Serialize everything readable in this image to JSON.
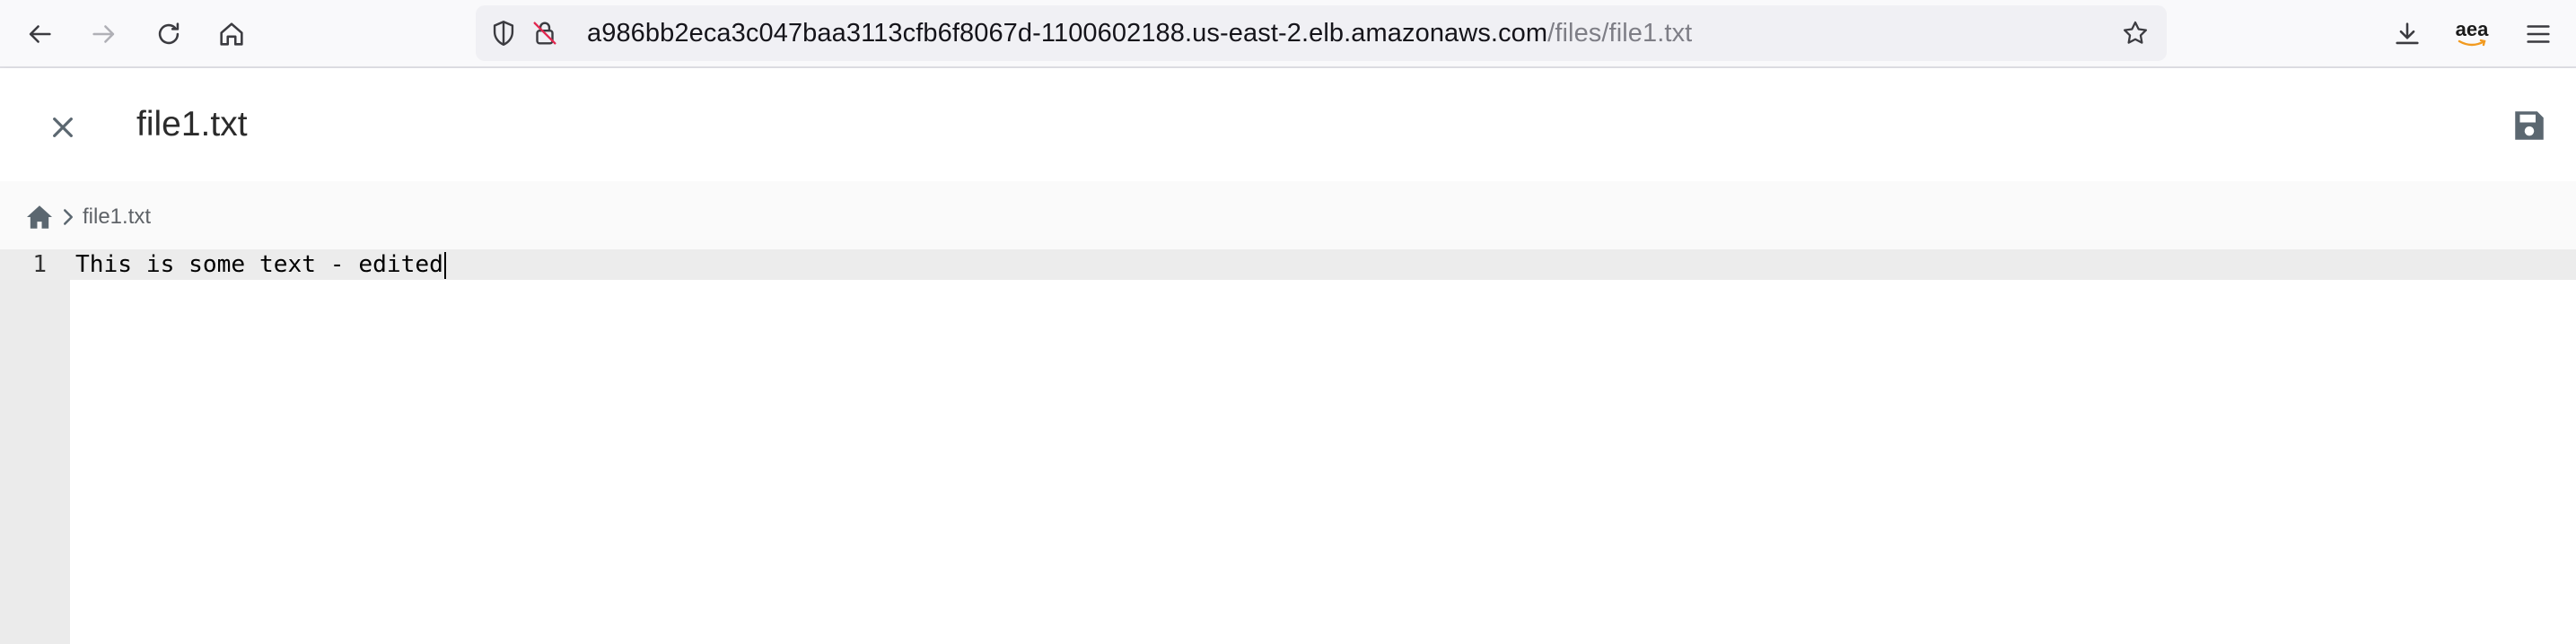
{
  "browser": {
    "url_host": "a986bb2eca3c047baa3113cfb6f8067d-1100602188.us-east-2.elb.amazonaws.com",
    "url_path": "/files/file1.txt",
    "account_label": "aea",
    "icons": [
      "back-icon",
      "forward-icon",
      "reload-icon",
      "home-icon",
      "shield-icon",
      "insecure-lock-icon",
      "bookmark-star-icon",
      "download-icon",
      "amazon-account-icon",
      "menu-icon"
    ]
  },
  "header": {
    "title": "file1.txt",
    "icons": [
      "close-icon",
      "save-icon"
    ]
  },
  "breadcrumb": {
    "items": [
      "file1.txt"
    ],
    "icons": [
      "home-icon",
      "chevron-right-icon"
    ]
  },
  "editor": {
    "lines": [
      {
        "number": "1",
        "text": "This is some text - edited"
      }
    ]
  },
  "colors": {
    "browser_bg": "#f9f9fb",
    "urlbar_bg": "#f0f0f4",
    "icon_gray": "#5b6770",
    "gutter_bg": "#ebebeb",
    "active_line_bg": "#ececec"
  }
}
